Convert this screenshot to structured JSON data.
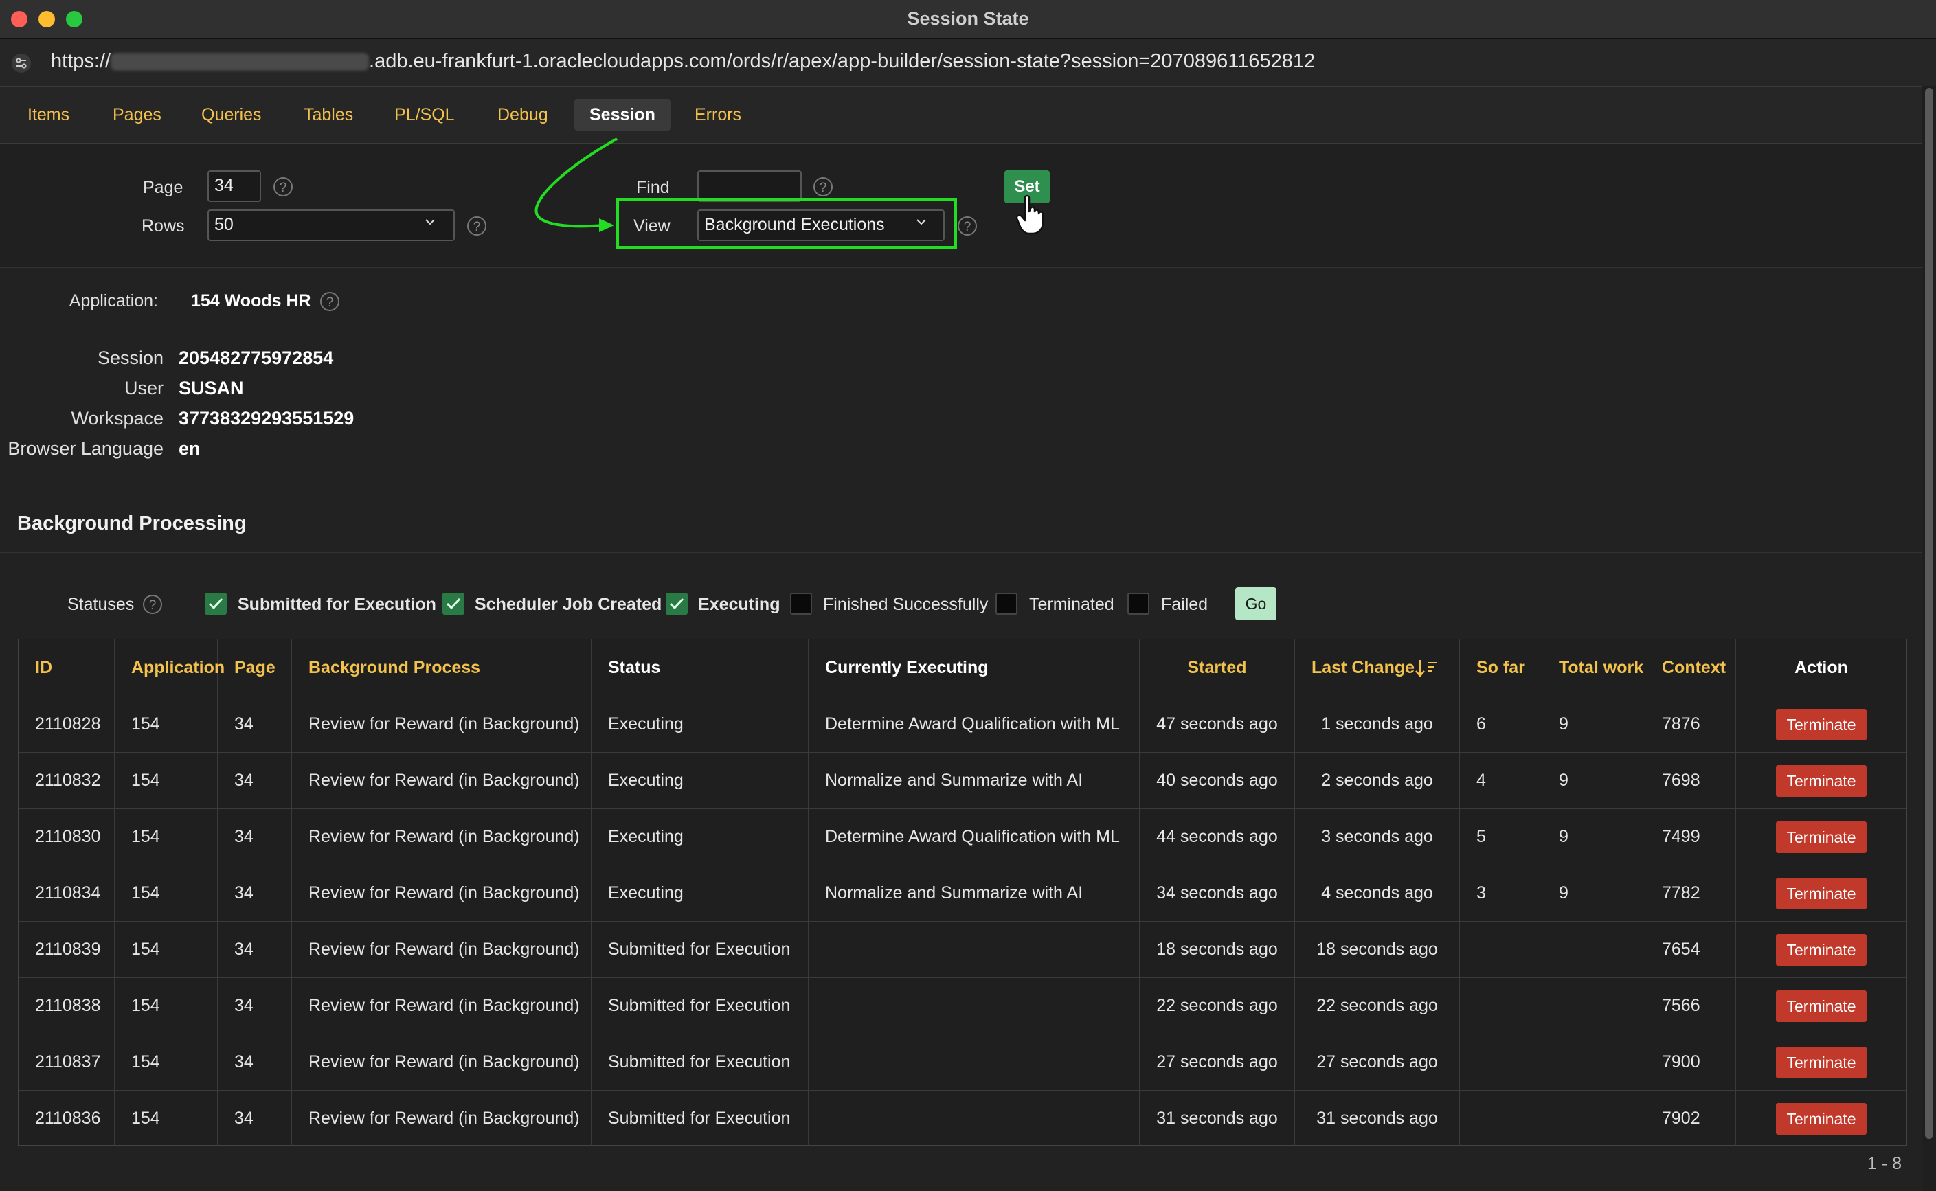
{
  "window": {
    "title": "Session State",
    "colors": {
      "close": "#ff5f57",
      "minimize": "#febc2e",
      "zoom": "#28c840",
      "accent": "#f3c24d",
      "set_button": "#2f8f4e",
      "terminate": "#c0392b",
      "highlight_box": "#22dd22"
    }
  },
  "browser": {
    "url_prefix": "https://",
    "url_suffix": ".adb.eu-frankfurt-1.oraclecloudapps.com/ords/r/apex/app-builder/session-state?session=207089611652812"
  },
  "tabs": [
    {
      "label": "Items"
    },
    {
      "label": "Pages"
    },
    {
      "label": "Queries"
    },
    {
      "label": "Tables"
    },
    {
      "label": "PL/SQL"
    },
    {
      "label": "Debug"
    },
    {
      "label": "Session",
      "active": true
    },
    {
      "label": "Errors"
    }
  ],
  "filters": {
    "page_label": "Page",
    "page_value": "34",
    "rows_label": "Rows",
    "rows_value": "50",
    "find_label": "Find",
    "find_value": "",
    "view_label": "View",
    "view_value": "Background Executions",
    "set_label": "Set",
    "help_glyph": "?"
  },
  "info": {
    "application_label": "Application:",
    "application_value": "154 Woods HR",
    "session_label": "Session",
    "session_value": "205482775972854",
    "user_label": "User",
    "user_value": "SUSAN",
    "workspace_label": "Workspace",
    "workspace_value": "37738329293551529",
    "language_label": "Browser Language",
    "language_value": "en"
  },
  "background": {
    "title": "Background Processing",
    "statuses_label": "Statuses",
    "statuses": [
      {
        "label": "Submitted for Execution",
        "checked": true
      },
      {
        "label": "Scheduler Job Created",
        "checked": true
      },
      {
        "label": "Executing",
        "checked": true
      },
      {
        "label": "Finished Successfully",
        "checked": false
      },
      {
        "label": "Terminated",
        "checked": false
      },
      {
        "label": "Failed",
        "checked": false
      }
    ],
    "go_label": "Go"
  },
  "table": {
    "columns": [
      "ID",
      "Application",
      "Page",
      "Background Process",
      "Status",
      "Currently Executing",
      "Started",
      "Last Change",
      "So far",
      "Total work",
      "Context",
      "Action"
    ],
    "sort_icon": "sort-descending-icon",
    "action_label": "Terminate",
    "rows": [
      [
        "2110828",
        "154",
        "34",
        "Review for Reward (in Background)",
        "Executing",
        "Determine Award Qualification with ML",
        "47 seconds ago",
        "1 seconds ago",
        "6",
        "9",
        "7876"
      ],
      [
        "2110832",
        "154",
        "34",
        "Review for Reward (in Background)",
        "Executing",
        "Normalize and Summarize with AI",
        "40 seconds ago",
        "2 seconds ago",
        "4",
        "9",
        "7698"
      ],
      [
        "2110830",
        "154",
        "34",
        "Review for Reward (in Background)",
        "Executing",
        "Determine Award Qualification with ML",
        "44 seconds ago",
        "3 seconds ago",
        "5",
        "9",
        "7499"
      ],
      [
        "2110834",
        "154",
        "34",
        "Review for Reward (in Background)",
        "Executing",
        "Normalize and Summarize with AI",
        "34 seconds ago",
        "4 seconds ago",
        "3",
        "9",
        "7782"
      ],
      [
        "2110839",
        "154",
        "34",
        "Review for Reward (in Background)",
        "Submitted for Execution",
        "",
        "18 seconds ago",
        "18 seconds ago",
        "",
        "",
        "7654"
      ],
      [
        "2110838",
        "154",
        "34",
        "Review for Reward (in Background)",
        "Submitted for Execution",
        "",
        "22 seconds ago",
        "22 seconds ago",
        "",
        "",
        "7566"
      ],
      [
        "2110837",
        "154",
        "34",
        "Review for Reward (in Background)",
        "Submitted for Execution",
        "",
        "27 seconds ago",
        "27 seconds ago",
        "",
        "",
        "7900"
      ],
      [
        "2110836",
        "154",
        "34",
        "Review for Reward (in Background)",
        "Submitted for Execution",
        "",
        "31 seconds ago",
        "31 seconds ago",
        "",
        "",
        "7902"
      ]
    ],
    "pager": "1 - 8"
  }
}
